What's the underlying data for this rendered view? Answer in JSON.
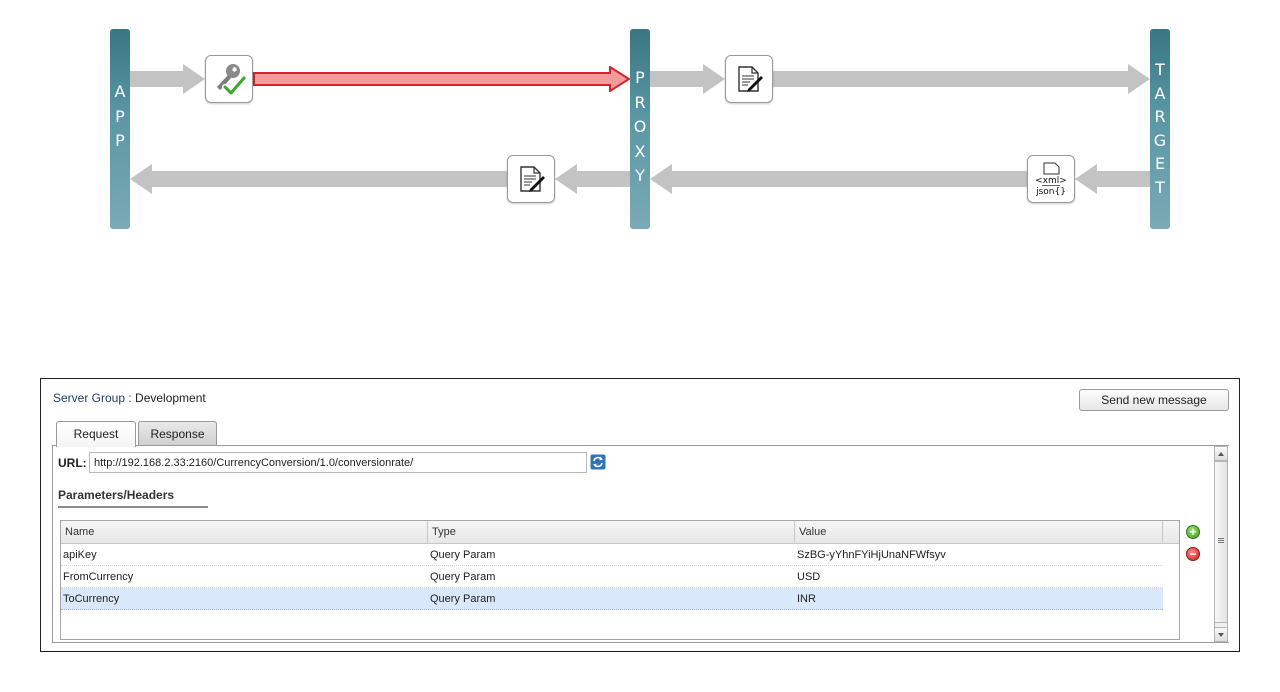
{
  "flow": {
    "app_label": [
      "A",
      "P",
      "P"
    ],
    "proxy_label": [
      "P",
      "R",
      "O",
      "X",
      "Y"
    ],
    "target_label": [
      "T",
      "A",
      "R",
      "G",
      "E",
      "T"
    ],
    "policies": {
      "verify_api_key": "key-check-icon",
      "request_transform": "edit-document-icon",
      "response_transform": "edit-document-icon",
      "xml_to_json": "xml-json-icon"
    },
    "xml_text": "<xml>",
    "json_text": "json{}",
    "highlight_color": "#e0262b",
    "bar_color": "#4e8a99",
    "arrow_color": "#c3c3c3"
  },
  "panel": {
    "server_group_label": "Server Group : ",
    "server_group_value": "Development",
    "send_button": "Send new message",
    "tabs": [
      {
        "label": "Request",
        "active": true
      },
      {
        "label": "Response",
        "active": false
      }
    ],
    "url_label": "URL:",
    "url_value": "http://192.168.2.33:2160/CurrencyConversion/1.0/conversionrate/",
    "params_title": "Parameters/Headers",
    "columns": [
      "Name",
      "Type",
      "Value"
    ],
    "rows": [
      {
        "name": "apiKey",
        "type": "Query Param",
        "value": "SzBG-yYhnFYiHjUnaNFWfsyv",
        "selected": false
      },
      {
        "name": "FromCurrency",
        "type": "Query Param",
        "value": "USD",
        "selected": false
      },
      {
        "name": "ToCurrency",
        "type": "Query Param",
        "value": "INR",
        "selected": true
      }
    ],
    "add_symbol": "+",
    "remove_symbol": "−"
  }
}
